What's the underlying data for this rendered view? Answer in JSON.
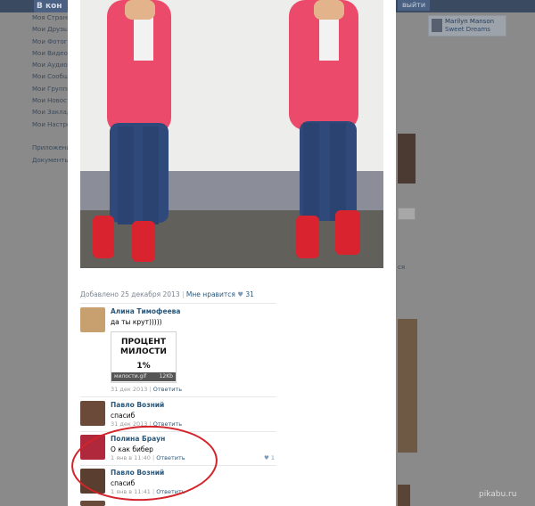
{
  "header": {
    "logo_text": "В кон",
    "exit_label": "выйти"
  },
  "left_menu": [
    "Моя Страница",
    "Мои Друзья",
    "Мои Фотографии",
    "Мои Видеозаписи",
    "Мои Аудиозаписи",
    "Мои Сообщения",
    "Мои Группы",
    "Мои Новости",
    "Мои Закладки",
    "Мои Настройки",
    "",
    "Приложения",
    "Документы"
  ],
  "audio_player": {
    "artist": "Marilyn Manson",
    "song": "Sweet Dreams"
  },
  "photo_meta": {
    "added": "Добавлено 25 декабря 2013",
    "like_label": "Мне нравится",
    "like_count": "31"
  },
  "comments": [
    {
      "name": "Алина Тимофеева",
      "text": "да ты крут)))))",
      "date": "31 дек 2013",
      "reply": "Ответить",
      "likes": "",
      "avatar_color": "#c8a070",
      "attachment": {
        "line1": "ПРОЦЕНТ",
        "line2": "МИЛОСТИ",
        "percent": "1%",
        "file": "милости.gif",
        "size": "12Kb"
      }
    },
    {
      "name": "Павло Возний",
      "text": "спасиб",
      "date": "31 дек 2013",
      "reply": "Ответить",
      "likes": "",
      "avatar_color": "#6b4a3a"
    },
    {
      "name": "Полина Браун",
      "text": "О как бибер",
      "date": "1 янв в 11:40",
      "reply": "Ответить",
      "likes": "1",
      "avatar_color": "#b0283c"
    },
    {
      "name": "Павло Возний",
      "text": "спасиб",
      "date": "1 янв в 11:41",
      "reply": "Ответить",
      "likes": "",
      "avatar_color": "#5a3e30"
    }
  ],
  "side_text": "ся",
  "watermark": "pikabu.ru",
  "colors": {
    "link": "#2b587a",
    "highlight_circle": "#d4232a",
    "topbar": "#3a4a60"
  }
}
